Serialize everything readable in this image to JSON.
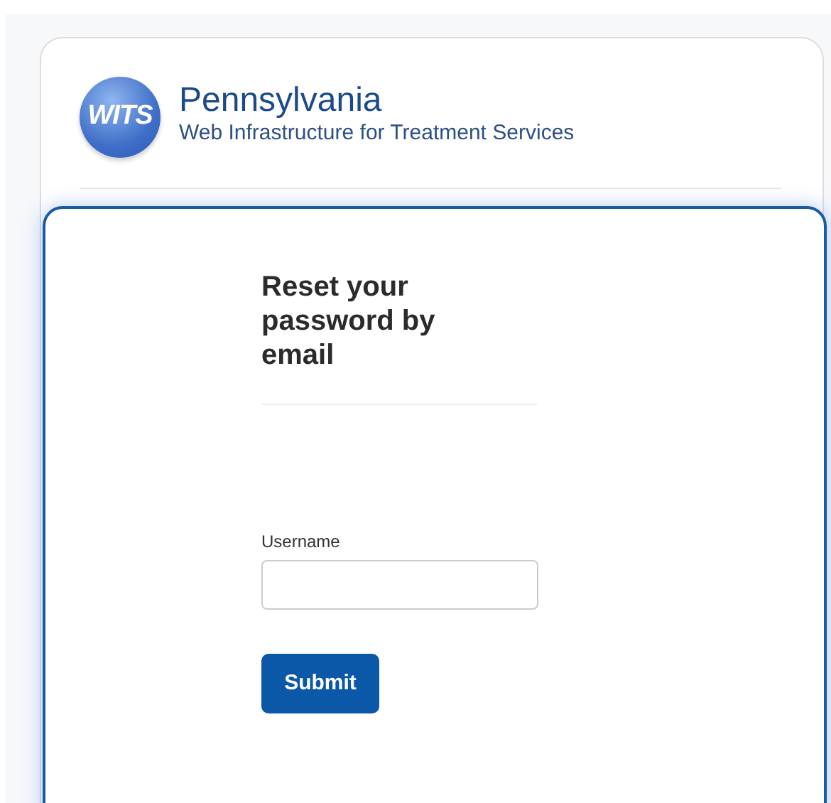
{
  "header": {
    "logo_text": "WITS",
    "title": "Pennsylvania",
    "subtitle": "Web Infrastructure for Treatment Services"
  },
  "form": {
    "heading": "Reset your password by email",
    "field": {
      "label": "Username"
    },
    "button": "Submit"
  }
}
